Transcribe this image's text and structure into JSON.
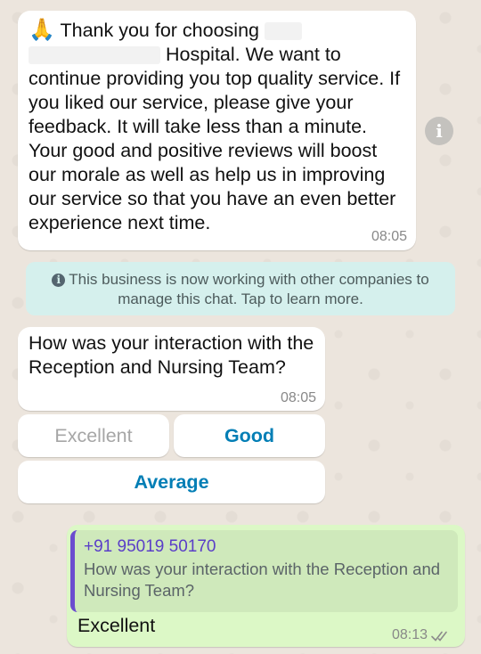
{
  "messages": {
    "welcome": {
      "emoji": "🙏",
      "line1": "Thank you for choosing",
      "redacted_name": "████",
      "redacted_prefix": "█████████",
      "line2_rest": "Hospital. We want to",
      "body": "continue providing you top quality service. If you liked our service, please give your feedback. It will take less than a minute. Your good and positive reviews will boost our morale as well as help us in improving our service so that you have an even better experience next time.",
      "time": "08:05"
    },
    "notice": {
      "text": "This business is now working with other companies to manage this chat. Tap to learn more."
    },
    "question": {
      "text": "How was your interaction with the Reception and Nursing Team?",
      "time": "08:05"
    },
    "quick_replies": [
      {
        "label": "Excellent",
        "state": "disabled"
      },
      {
        "label": "Good",
        "state": "active"
      },
      {
        "label": "Average",
        "state": "active"
      }
    ],
    "reply": {
      "quoted_sender": "+91 95019 50170",
      "quoted_text": "How was your interaction with the Reception and Nursing Team?",
      "text": "Excellent",
      "time": "08:13",
      "status": "read"
    }
  },
  "colors": {
    "chat_background": "#ece5dd",
    "incoming_bubble": "#ffffff",
    "outgoing_bubble": "#dcf8c6",
    "notice_background": "#d5f0ed",
    "quick_reply_text": "#027eb5",
    "quote_bar": "#6b4ccf",
    "read_ticks": "#8c8c8c"
  },
  "icons": {
    "info_button": "info-icon",
    "notice": "info-circle-icon",
    "status": "double-check-icon"
  }
}
